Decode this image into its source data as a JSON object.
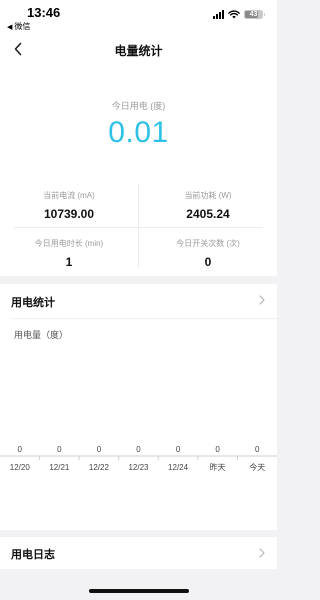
{
  "status_bar": {
    "time": "13:46",
    "back_app": "微信",
    "battery": "43"
  },
  "nav": {
    "title": "电量统计",
    "back_icon": "chevron-left-icon"
  },
  "summary": {
    "today_label": "今日用电 (度)",
    "today_value": "0.01",
    "current_label": "当前电流 (mA)",
    "current_value": "10739.00",
    "power_label": "当前功耗 (W)",
    "power_value": "2405.24",
    "duration_label": "今日用电时长 (min)",
    "duration_value": "1",
    "switch_label": "今日开关次数 (次)",
    "switch_value": "0"
  },
  "chart_section": {
    "title": "用电统计",
    "chevron_icon": "chevron-right-icon"
  },
  "chart_data": {
    "type": "bar",
    "ylabel": "用电量（度）",
    "categories": [
      "12/20",
      "12/21",
      "12/22",
      "12/23",
      "12/24",
      "昨天",
      "今天"
    ],
    "values": [
      0,
      0,
      0,
      0,
      0,
      0,
      0
    ]
  },
  "log_section": {
    "title": "用电日志",
    "chevron_icon": "chevron-right-icon"
  },
  "colors": {
    "accent": "#2fc2e6",
    "background": "#f2f2f4"
  }
}
